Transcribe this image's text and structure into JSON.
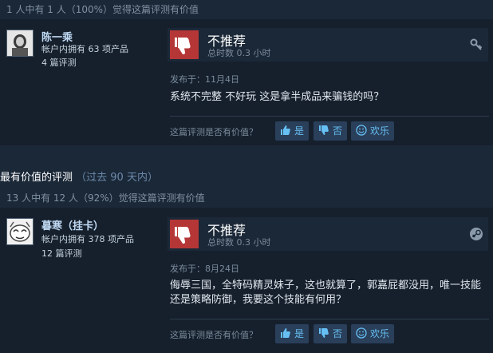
{
  "reviews": [
    {
      "helpful_text": "1 人中有 1 人（100%）觉得这篇评测有价值",
      "author_name": "陈一乘",
      "products_owned": "帐户内拥有 63 项产品",
      "reviews_count": "4 篇评测",
      "verdict": "不推荐",
      "hours": "总时数 0.3 小时",
      "posted": "发布于：11月4日",
      "text": "系统不完整 不好玩 这是拿半成品来骗钱的吗？",
      "vote_question": "这篇评测是否有价值？",
      "yes_label": "是",
      "no_label": "否",
      "funny_label": "欢乐",
      "corner_icon": "key-icon"
    },
    {
      "helpful_text": "13 人中有 12 人（92%）觉得这篇评测有价值",
      "author_name": "暮寒（挂卡）",
      "products_owned": "帐户内拥有 378 项产品",
      "reviews_count": "12 篇评测",
      "verdict": "不推荐",
      "hours": "总时数 0.3 小时",
      "posted": "发布于：8月24日",
      "text": "侮辱三国，全特码精灵妹子，这也就算了，郭嘉屁都没用，唯一技能还是策略防御，我要这个技能有何用？",
      "vote_question": "这篇评测是否有价值？",
      "yes_label": "是",
      "no_label": "否",
      "funny_label": "欢乐",
      "corner_icon": "steam-icon"
    }
  ],
  "section": {
    "title": "最有价值的评测",
    "subtitle": "（过去 90 天内）"
  },
  "colors": {
    "background": "#1b2838",
    "card": "#16202d",
    "thumb_down_box": "#b53636",
    "vote_button": "#2a3f5a",
    "link_blue": "#66c0f4"
  }
}
